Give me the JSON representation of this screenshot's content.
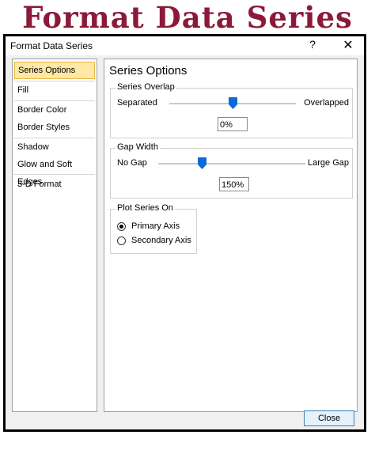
{
  "banner": {
    "text": "Format Data Series"
  },
  "dialog": {
    "title": "Format Data Series",
    "help_glyph": "?",
    "close_glyph": "✕"
  },
  "nav": {
    "items": [
      {
        "label": "Series Options",
        "selected": true
      },
      {
        "label": "Fill"
      },
      {
        "label": "Border Color"
      },
      {
        "label": "Border Styles"
      },
      {
        "label": "Shadow"
      },
      {
        "label": "Glow and Soft Edges"
      },
      {
        "label": "3-D Format"
      }
    ]
  },
  "content": {
    "title": "Series Options",
    "series_overlap": {
      "label": "Series Overlap",
      "left_label": "Separated",
      "right_label": "Overlapped",
      "value_text": "0%",
      "slider_fraction": 0.5
    },
    "gap_width": {
      "label": "Gap Width",
      "left_label": "No Gap",
      "right_label": "Large Gap",
      "value_text": "150%",
      "slider_fraction": 0.3
    },
    "plot_series_on": {
      "label": "Plot Series On",
      "primary": "Primary Axis",
      "secondary": "Secondary Axis",
      "selected": "primary"
    }
  },
  "buttons": {
    "close": "Close"
  },
  "colors": {
    "banner": "#8b1a3a",
    "selection": "#ffe8a6",
    "accent": "#0066cc"
  }
}
